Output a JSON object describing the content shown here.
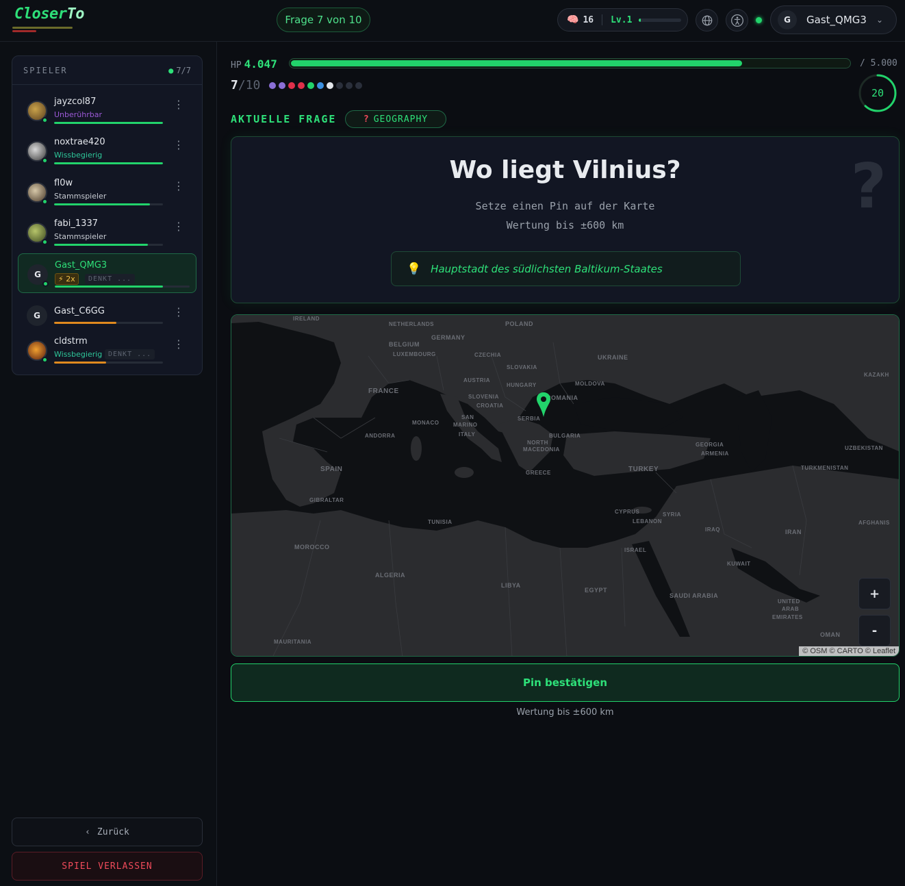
{
  "header": {
    "logo": {
      "part1": "Closer",
      "part2": "To"
    },
    "question_pill": "Frage 7 von 10",
    "brain_count": "16",
    "level": "Lv.1",
    "level_progress": 0.04,
    "user": {
      "initial": "G",
      "name": "Gast_QMG3"
    }
  },
  "sidebar": {
    "players_title": "SPIELER",
    "players_count": "7/7",
    "players": [
      {
        "name": "jayzcol87",
        "title": "Unberührbar",
        "title_color": "#9b59d6",
        "hp": 1.0,
        "hp_color": "#22d36b",
        "avatar": "img"
      },
      {
        "name": "noxtrae420",
        "title": "Wissbegierig",
        "title_color": "#2ec79a",
        "hp": 1.0,
        "hp_color": "#22d36b",
        "avatar": "img"
      },
      {
        "name": "fl0w",
        "title": "Stammspieler",
        "title_color": "#c7cbd2",
        "hp": 0.88,
        "hp_color": "#22d36b",
        "avatar": "img"
      },
      {
        "name": "fabi_1337",
        "title": "Stammspieler",
        "title_color": "#c7cbd2",
        "hp": 0.86,
        "hp_color": "#22d36b",
        "avatar": "img"
      },
      {
        "name": "Gast_QMG3",
        "badge": "⚡ 2x",
        "status": "DENKT ...",
        "hp": 0.8,
        "hp_color": "#22d36b",
        "avatar": "G"
      },
      {
        "name": "Gast_C6GG",
        "hp": 0.57,
        "hp_color": "#e08a1e",
        "avatar": "G"
      },
      {
        "name": "cldstrm",
        "title": "Wissbegierig",
        "title_color": "#2ec79a",
        "status": "DENKT ...",
        "hp": 0.48,
        "hp_color": "#e08a1e",
        "avatar": "img"
      }
    ],
    "back_label": "Zurück",
    "leave_label": "SPIEL VERLASSEN"
  },
  "main": {
    "hp_label": "HP",
    "hp_value": "4.047",
    "hp_max": "/ 5.000",
    "hp_fraction": 0.809,
    "round_current": "7",
    "round_total": "/10",
    "round_dots": [
      "#8b6fd6",
      "#8b6fd6",
      "#e0304a",
      "#e0304a",
      "#22d36b",
      "#3b8fe0",
      "#e3e6eb",
      "#2a2f3b",
      "#2a2f3b",
      "#2a2f3b"
    ],
    "timer": "20",
    "timer_fraction": 0.62,
    "current_question_label": "AKTUELLE FRAGE",
    "category": "GEOGRAPHY",
    "question": "Wo liegt Vilnius?",
    "instruction": "Setze einen Pin auf der Karte",
    "scoring": "Wertung bis ±600 km",
    "hint": "Hauptstadt des südlichsten Baltikum-Staates",
    "confirm_label": "Pin bestätigen",
    "bottom_note": "Wertung bis ±600 km"
  },
  "map": {
    "zoom_in": "+",
    "zoom_out": "-",
    "attribution": "© OSM © CARTO © Leaflet",
    "labels": [
      "IRELAND",
      "NETHERLANDS",
      "POLAND",
      "BELGIUM",
      "GERMANY",
      "LUXEMBOURG",
      "CZECHIA",
      "UKRAINE",
      "KAZAKH",
      "SLOVAKIA",
      "AUSTRIA",
      "HUNGARY",
      "MOLDOVA",
      "FRANCE",
      "SLOVENIA",
      "CROATIA",
      "ROMANIA",
      "SAN",
      "MARINO",
      "MONACO",
      "SERBIA",
      "ANDORRA",
      "ITALY",
      "BULGARIA",
      "NORTH",
      "MACEDONIA",
      "GEORGIA",
      "ARMENIA",
      "UZBEKISTAN",
      "SPAIN",
      "GREECE",
      "TURKEY",
      "TURKMENISTAN",
      "GIBRALTAR",
      "CYPRUS",
      "LEBANON",
      "SYRIA",
      "TUNISIA",
      "IRAQ",
      "IRAN",
      "AFGHANIS",
      "MOROCCO",
      "ISRAEL",
      "KUWAIT",
      "ALGERIA",
      "LIBYA",
      "EGYPT",
      "SAUDI ARABIA",
      "UNITED",
      "ARAB",
      "EMIRATES",
      "OMAN",
      "MAURITANIA"
    ]
  }
}
